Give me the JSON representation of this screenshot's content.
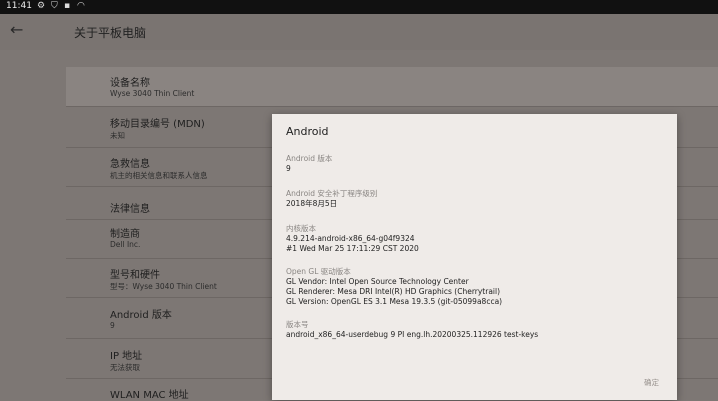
{
  "status_bar": {
    "time": "11:41",
    "icons": [
      "gear-icon",
      "shield-icon",
      "notification-icon",
      "wifi-icon"
    ]
  },
  "header": {
    "title": "关于平板电脑"
  },
  "list": {
    "items": [
      {
        "title": "设备名称",
        "subtitle": "Wyse 3040 Thin Client"
      },
      {
        "title": "移动目录编号 (MDN)",
        "subtitle": "未知"
      },
      {
        "title": "急救信息",
        "subtitle": "机主的相关信息和联系人信息"
      },
      {
        "title": "法律信息",
        "subtitle": ""
      },
      {
        "title": "制造商",
        "subtitle": "Dell Inc."
      },
      {
        "title": "型号和硬件",
        "subtitle": "型号：Wyse 3040 Thin Client"
      },
      {
        "title": "Android 版本",
        "subtitle": "9"
      },
      {
        "title": "IP 地址",
        "subtitle": "无法获取"
      },
      {
        "title": "WLAN MAC 地址",
        "subtitle": ""
      }
    ]
  },
  "dialog": {
    "title": "Android",
    "sections": [
      {
        "heading": "Android 版本",
        "lines": [
          "9"
        ]
      },
      {
        "heading": "Android 安全补丁程序级别",
        "lines": [
          "2018年8月5日"
        ]
      },
      {
        "heading": "内核版本",
        "lines": [
          "4.9.214-android-x86_64-g04f9324",
          "#1 Wed Mar 25 17:11:29 CST 2020"
        ]
      },
      {
        "heading": "Open GL 驱动版本",
        "lines": [
          "GL Vendor: Intel Open Source Technology Center",
          "GL Renderer: Mesa DRI Intel(R) HD Graphics (Cherrytrail)",
          "GL Version: OpenGL ES 3.1 Mesa 19.3.5 (git-05099a8cca)"
        ]
      },
      {
        "heading": "版本号",
        "lines": [
          "android_x86_64-userdebug 9 PI eng.lh.20200325.112926 test-keys"
        ]
      }
    ],
    "ok_label": "确定"
  }
}
